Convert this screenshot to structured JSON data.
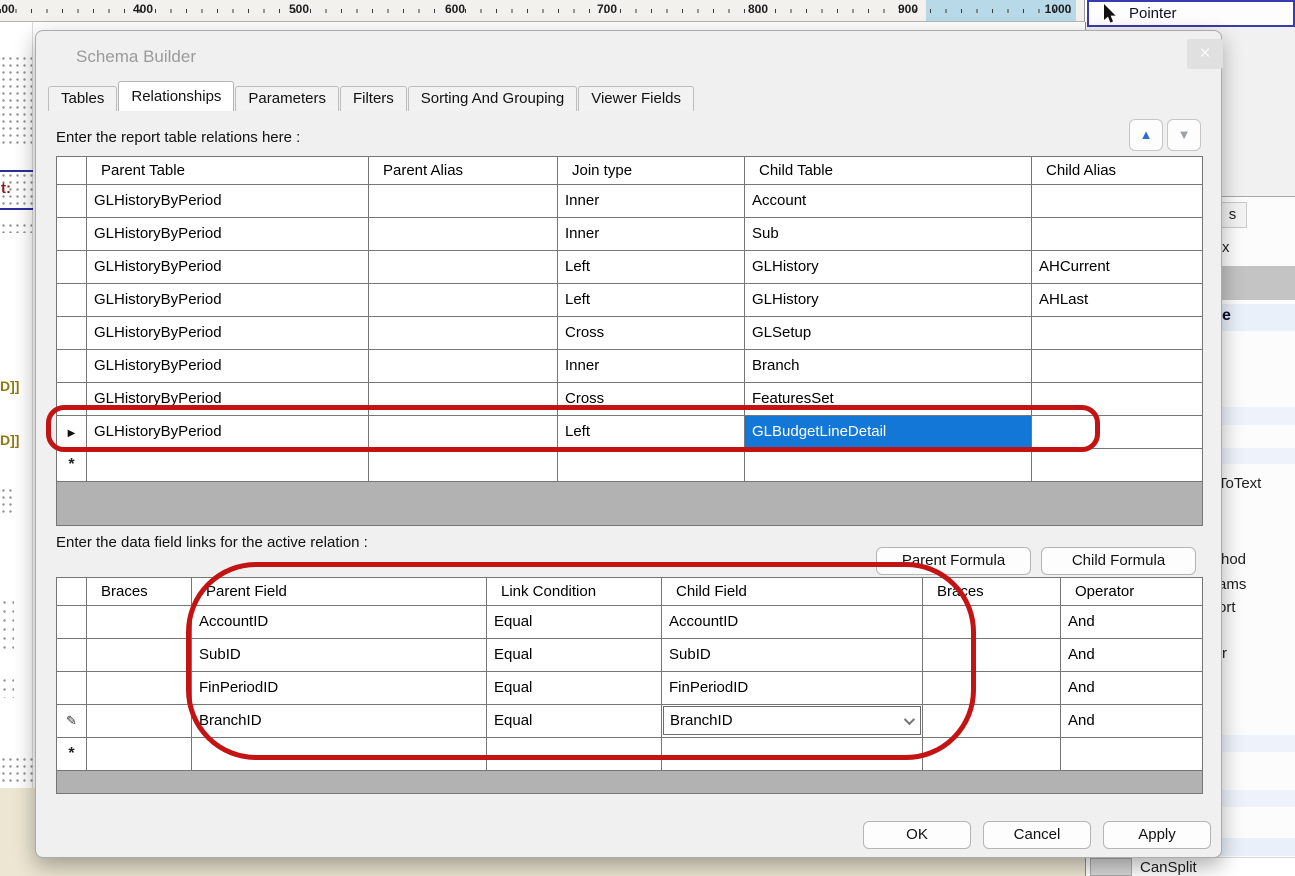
{
  "ruler": {
    "labels": [
      "00",
      "400",
      "500",
      "600",
      "700",
      "800",
      "900",
      "1000"
    ]
  },
  "toolbox": {
    "pointer_label": "Pointer"
  },
  "icons": {
    "close": "×",
    "up_arrow": "▲",
    "down_arrow": "▼",
    "active_row_marker": "▶",
    "new_row_marker": "*",
    "edit_row_marker": "✎"
  },
  "dialog": {
    "title": "Schema Builder",
    "tabs": [
      "Tables",
      "Relationships",
      "Parameters",
      "Filters",
      "Sorting And Grouping",
      "Viewer Fields"
    ],
    "relations": {
      "label": "Enter the report table relations here :",
      "columns": [
        "Parent Table",
        "Parent Alias",
        "Join type",
        "Child Table",
        "Child Alias"
      ],
      "rows": [
        {
          "parent_table": "GLHistoryByPeriod",
          "parent_alias": "",
          "join_type": "Inner",
          "child_table": "Account",
          "child_alias": ""
        },
        {
          "parent_table": "GLHistoryByPeriod",
          "parent_alias": "",
          "join_type": "Inner",
          "child_table": "Sub",
          "child_alias": ""
        },
        {
          "parent_table": "GLHistoryByPeriod",
          "parent_alias": "",
          "join_type": "Left",
          "child_table": "GLHistory",
          "child_alias": "AHCurrent"
        },
        {
          "parent_table": "GLHistoryByPeriod",
          "parent_alias": "",
          "join_type": "Left",
          "child_table": "GLHistory",
          "child_alias": "AHLast"
        },
        {
          "parent_table": "GLHistoryByPeriod",
          "parent_alias": "",
          "join_type": "Cross",
          "child_table": "GLSetup",
          "child_alias": ""
        },
        {
          "parent_table": "GLHistoryByPeriod",
          "parent_alias": "",
          "join_type": "Inner",
          "child_table": "Branch",
          "child_alias": ""
        },
        {
          "parent_table": "GLHistoryByPeriod",
          "parent_alias": "",
          "join_type": "Cross",
          "child_table": "FeaturesSet",
          "child_alias": ""
        },
        {
          "parent_table": "GLHistoryByPeriod",
          "parent_alias": "",
          "join_type": "Left",
          "child_table": "GLBudgetLineDetail",
          "child_alias": ""
        }
      ]
    },
    "links": {
      "label": "Enter the data field links for the active relation :",
      "parent_formula_button": "Parent Formula",
      "child_formula_button": "Child Formula",
      "columns": [
        "Braces",
        "Parent Field",
        "Link Condition",
        "Child Field",
        "Braces",
        "Operator"
      ],
      "rows": [
        {
          "braces": "",
          "parent_field": "AccountID",
          "link_condition": "Equal",
          "child_field": "AccountID",
          "braces2": "",
          "operator": "And"
        },
        {
          "braces": "",
          "parent_field": "SubID",
          "link_condition": "Equal",
          "child_field": "SubID",
          "braces2": "",
          "operator": "And"
        },
        {
          "braces": "",
          "parent_field": "FinPeriodID",
          "link_condition": "Equal",
          "child_field": "FinPeriodID",
          "braces2": "",
          "operator": "And"
        },
        {
          "braces": "",
          "parent_field": "BranchID",
          "link_condition": "Equal",
          "child_field": "BranchID",
          "braces2": "",
          "operator": "And"
        }
      ]
    },
    "footer": {
      "ok": "OK",
      "cancel": "Cancel",
      "apply": "Apply"
    }
  },
  "background": {
    "left_band_text": "t:",
    "left_fragments": [
      "D]]",
      "D]]"
    ],
    "right_tab_text": "s",
    "right_fragments": [
      "x",
      "e",
      "ToText",
      "hod",
      "ams",
      "ort",
      "r"
    ],
    "bottom_right_property": "CanSplit"
  },
  "colors": {
    "selection_blue": "#1277d6",
    "annotation_red": "#c31313",
    "ruler_highlight": "#b8d9e8"
  }
}
